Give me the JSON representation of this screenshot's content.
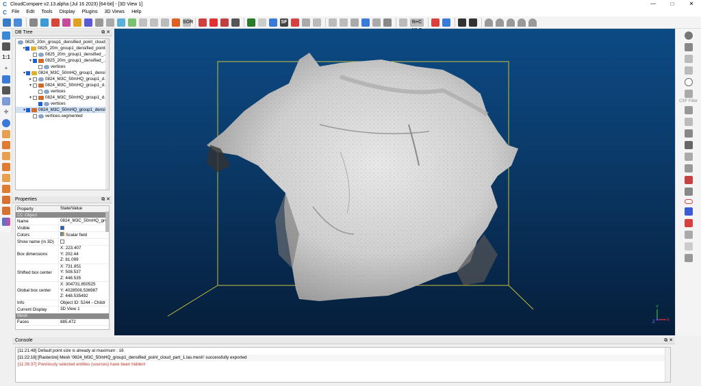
{
  "app": {
    "title": "CloudCompare v2.13.alpha (Jul 16 2023) [64-bit] - [3D View 1]",
    "logo_text": "C",
    "window_controls": [
      "—",
      "□",
      "✕"
    ]
  },
  "menu": [
    "File",
    "Edit",
    "Tools",
    "Display",
    "Plugins",
    "3D Views",
    "Help"
  ],
  "toolbar_labels": {
    "sor": "SOR",
    "sf": "SF",
    "ncmls": "N+C MLS"
  },
  "db_tree": {
    "title": "DB Tree",
    "dock_buttons": "⧉ ✕",
    "rows": [
      {
        "indent": 0,
        "arrow": "",
        "checked": false,
        "icon": "cloud",
        "label": "0825_20m_group1_densified_point_cloud...",
        "show_check": false
      },
      {
        "indent": 1,
        "arrow": "▾",
        "checked": true,
        "icon": "folder",
        "label": "0825_20m_group1_densified_point..."
      },
      {
        "indent": 2,
        "arrow": "",
        "checked": false,
        "icon": "cloud",
        "label": "0825_20m_group1_densified_..."
      },
      {
        "indent": 2,
        "arrow": "▾",
        "checked": true,
        "icon": "mesh",
        "label": "0825_20m_group1_densified_..."
      },
      {
        "indent": 3,
        "arrow": "",
        "checked": false,
        "icon": "cloud",
        "label": "vertices"
      },
      {
        "indent": 1,
        "arrow": "▾",
        "checked": true,
        "icon": "folder",
        "label": "0824_M3C_50mHQ_group1_densi..."
      },
      {
        "indent": 2,
        "arrow": "▸",
        "checked": false,
        "icon": "cloud",
        "label": "0824_M3C_50mHQ_group1_d..."
      },
      {
        "indent": 2,
        "arrow": "▾",
        "checked": false,
        "icon": "mesh",
        "label": "0824_M3C_50mHQ_group1_d..."
      },
      {
        "indent": 3,
        "arrow": "",
        "checked": false,
        "icon": "cloud",
        "label": "vertices"
      },
      {
        "indent": 2,
        "arrow": "▾",
        "checked": false,
        "icon": "mesh",
        "label": "0824_M3C_50mHQ_group1_d..."
      },
      {
        "indent": 3,
        "arrow": "",
        "checked": true,
        "icon": "cloud",
        "label": "vertices"
      },
      {
        "indent": 1,
        "arrow": "▾",
        "checked": true,
        "icon": "mesh",
        "label": "0824_M3C_50mHQ_group1_densi...",
        "selected": true
      },
      {
        "indent": 2,
        "arrow": "",
        "checked": false,
        "icon": "cloud",
        "label": "vertices.segmented"
      }
    ]
  },
  "properties": {
    "title": "Properties",
    "dock_buttons": "⧉ ✕",
    "header": [
      "Property",
      "State/Value"
    ],
    "rows": [
      {
        "section": "CC Object"
      },
      {
        "key": "Name",
        "value": [
          "0824_M3C_50mHQ_gro"
        ]
      },
      {
        "key": "Visible",
        "checkbox": true
      },
      {
        "key": "Colors",
        "value": [
          "Scalar field"
        ],
        "icon": true
      },
      {
        "key": "Show name (in 3D)",
        "checkbox": false
      },
      {
        "key": "Box dimensions",
        "value": [
          "X: 223.407",
          "Y: 202.44",
          "Z: 81.099"
        ]
      },
      {
        "key": "Shifted box center",
        "value": [
          "X: 731.851",
          "Y: 508.537",
          "Z: 448.535"
        ]
      },
      {
        "key": "Global box center",
        "value": [
          "X: 304731.850525",
          "Y: 4028508.536987",
          "Z: 448.535492"
        ]
      },
      {
        "key": "Info",
        "value": [
          "Object ID: 5244 - Childr"
        ]
      },
      {
        "key": "Current Display",
        "value": [
          "3D View 1"
        ]
      },
      {
        "section": "Mesh"
      },
      {
        "key": "Faces",
        "value": [
          "885.472"
        ]
      }
    ]
  },
  "right_toolbar": {
    "csf_label": "CSF Filter"
  },
  "view3d": {
    "axes": {
      "x": "X",
      "y": "Y",
      "z": "Z"
    }
  },
  "console": {
    "title": "Console",
    "dock_buttons": "⧉ ✕",
    "lines": [
      {
        "text": "[11:21:48] Default point size is already at maximum : 16",
        "type": "info"
      },
      {
        "text": "[11:22:18] [Rasterize] Mesh '0824_M3C_50mHQ_group1_densified_point_cloud_part_1.las.mesh' successfully exported",
        "type": "info"
      },
      {
        "text": "[11:26:37] Previously selected entities (sources) have been hidden!",
        "type": "error"
      }
    ]
  },
  "colors": {
    "bg_top": "#0c4a84",
    "bg_bottom": "#061e3a",
    "bbox": "#c8c23a",
    "error_text": "#c0302a",
    "selection": "#cfe0f7"
  }
}
